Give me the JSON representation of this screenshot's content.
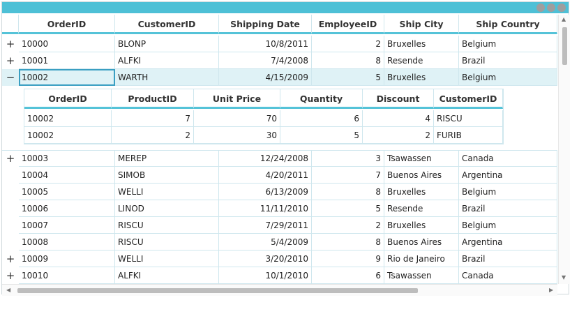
{
  "main_columns": [
    "OrderID",
    "CustomerID",
    "Shipping Date",
    "EmployeeID",
    "Ship City",
    "Ship Country"
  ],
  "rows": [
    {
      "expander": "+",
      "orderId": "10000",
      "customerId": "BLONP",
      "shippingDate": "10/8/2011",
      "employeeId": "2",
      "shipCity": "Bruxelles",
      "shipCountry": "Belgium"
    },
    {
      "expander": "+",
      "orderId": "10001",
      "customerId": "ALFKI",
      "shippingDate": "7/4/2008",
      "employeeId": "8",
      "shipCity": "Resende",
      "shipCountry": "Brazil"
    },
    {
      "expander": "−",
      "orderId": "10002",
      "customerId": "WARTH",
      "shippingDate": "4/15/2009",
      "employeeId": "5",
      "shipCity": "Bruxelles",
      "shipCountry": "Belgium"
    },
    {
      "expander": "+",
      "orderId": "10003",
      "customerId": "MEREP",
      "shippingDate": "12/24/2008",
      "employeeId": "3",
      "shipCity": "Tsawassen",
      "shipCountry": "Canada"
    },
    {
      "expander": "",
      "orderId": "10004",
      "customerId": "SIMOB",
      "shippingDate": "4/20/2011",
      "employeeId": "7",
      "shipCity": "Buenos Aires",
      "shipCountry": "Argentina"
    },
    {
      "expander": "",
      "orderId": "10005",
      "customerId": "WELLI",
      "shippingDate": "6/13/2009",
      "employeeId": "8",
      "shipCity": "Bruxelles",
      "shipCountry": "Belgium"
    },
    {
      "expander": "",
      "orderId": "10006",
      "customerId": "LINOD",
      "shippingDate": "11/11/2010",
      "employeeId": "5",
      "shipCity": "Resende",
      "shipCountry": "Brazil"
    },
    {
      "expander": "",
      "orderId": "10007",
      "customerId": "RISCU",
      "shippingDate": "7/29/2011",
      "employeeId": "2",
      "shipCity": "Bruxelles",
      "shipCountry": "Belgium"
    },
    {
      "expander": "",
      "orderId": "10008",
      "customerId": "RISCU",
      "shippingDate": "5/4/2009",
      "employeeId": "8",
      "shipCity": "Buenos Aires",
      "shipCountry": "Argentina"
    },
    {
      "expander": "+",
      "orderId": "10009",
      "customerId": "WELLI",
      "shippingDate": "3/20/2010",
      "employeeId": "9",
      "shipCity": "Rio de Janeiro",
      "shipCountry": "Brazil"
    },
    {
      "expander": "+",
      "orderId": "10010",
      "customerId": "ALFKI",
      "shippingDate": "10/1/2010",
      "employeeId": "6",
      "shipCity": "Tsawassen",
      "shipCountry": "Canada"
    }
  ],
  "detail_columns": [
    "OrderID",
    "ProductID",
    "Unit Price",
    "Quantity",
    "Discount",
    "CustomerID"
  ],
  "detail_rows": [
    {
      "orderId": "10002",
      "productId": "7",
      "unitPrice": "70",
      "quantity": "6",
      "discount": "4",
      "customerId": "RISCU"
    },
    {
      "orderId": "10002",
      "productId": "2",
      "unitPrice": "30",
      "quantity": "5",
      "discount": "2",
      "customerId": "FURIB"
    }
  ],
  "colors": {
    "titlebar": "#4ec0d6",
    "header_underline": "#55c3d8",
    "selected_row": "#dff2f6",
    "grid_line": "#cfe7ee"
  }
}
